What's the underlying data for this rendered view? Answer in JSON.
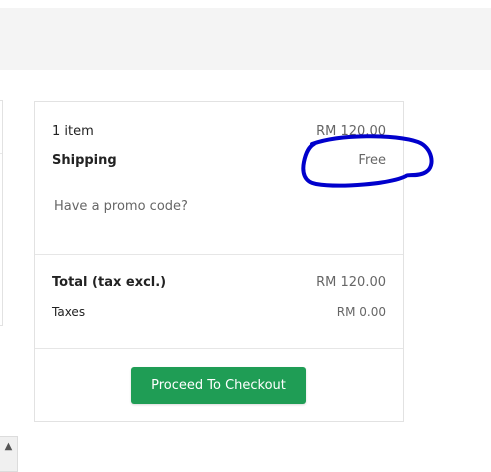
{
  "summary": {
    "items_label": "1 item",
    "items_value": "RM 120.00",
    "shipping_label": "Shipping",
    "shipping_value": "Free",
    "promo_link": "Have a promo code?",
    "total_label": "Total (tax excl.)",
    "total_value": "RM 120.00",
    "taxes_label": "Taxes",
    "taxes_value": "RM 0.00",
    "checkout_label": "Proceed To Checkout"
  },
  "colors": {
    "checkout_button": "#1f9d55",
    "annotation_ink": "#0000cc",
    "top_band": "#f4f4f4"
  },
  "icons": {
    "scroll_up": "chevron-up-icon"
  }
}
